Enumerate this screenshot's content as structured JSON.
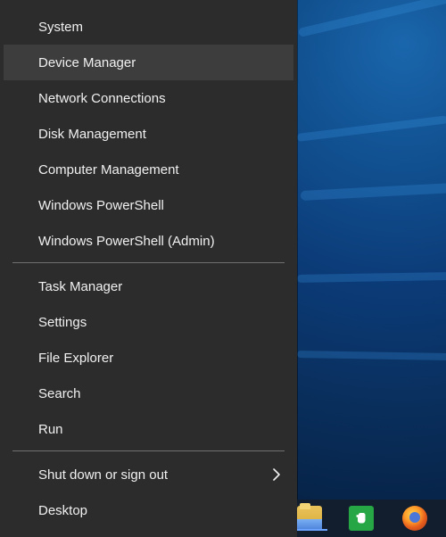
{
  "menu": {
    "items": [
      {
        "label": "System"
      },
      {
        "label": "Device Manager"
      },
      {
        "label": "Network Connections"
      },
      {
        "label": "Disk Management"
      },
      {
        "label": "Computer Management"
      },
      {
        "label": "Windows PowerShell"
      },
      {
        "label": "Windows PowerShell (Admin)"
      },
      {
        "label": "Task Manager"
      },
      {
        "label": "Settings"
      },
      {
        "label": "File Explorer"
      },
      {
        "label": "Search"
      },
      {
        "label": "Run"
      },
      {
        "label": "Shut down or sign out"
      },
      {
        "label": "Desktop"
      }
    ],
    "hovered_item": "Device Manager",
    "submenu_icon": "chevron-right-icon"
  },
  "taskbar": {
    "icons": [
      {
        "name": "file-explorer-icon"
      },
      {
        "name": "evernote-icon"
      },
      {
        "name": "firefox-icon"
      }
    ]
  },
  "colors": {
    "menu_background": "#2c2c2c",
    "menu_hover": "#3d3d3d",
    "menu_text": "#f1f1f1",
    "desktop_blue": "#0c3f80"
  }
}
